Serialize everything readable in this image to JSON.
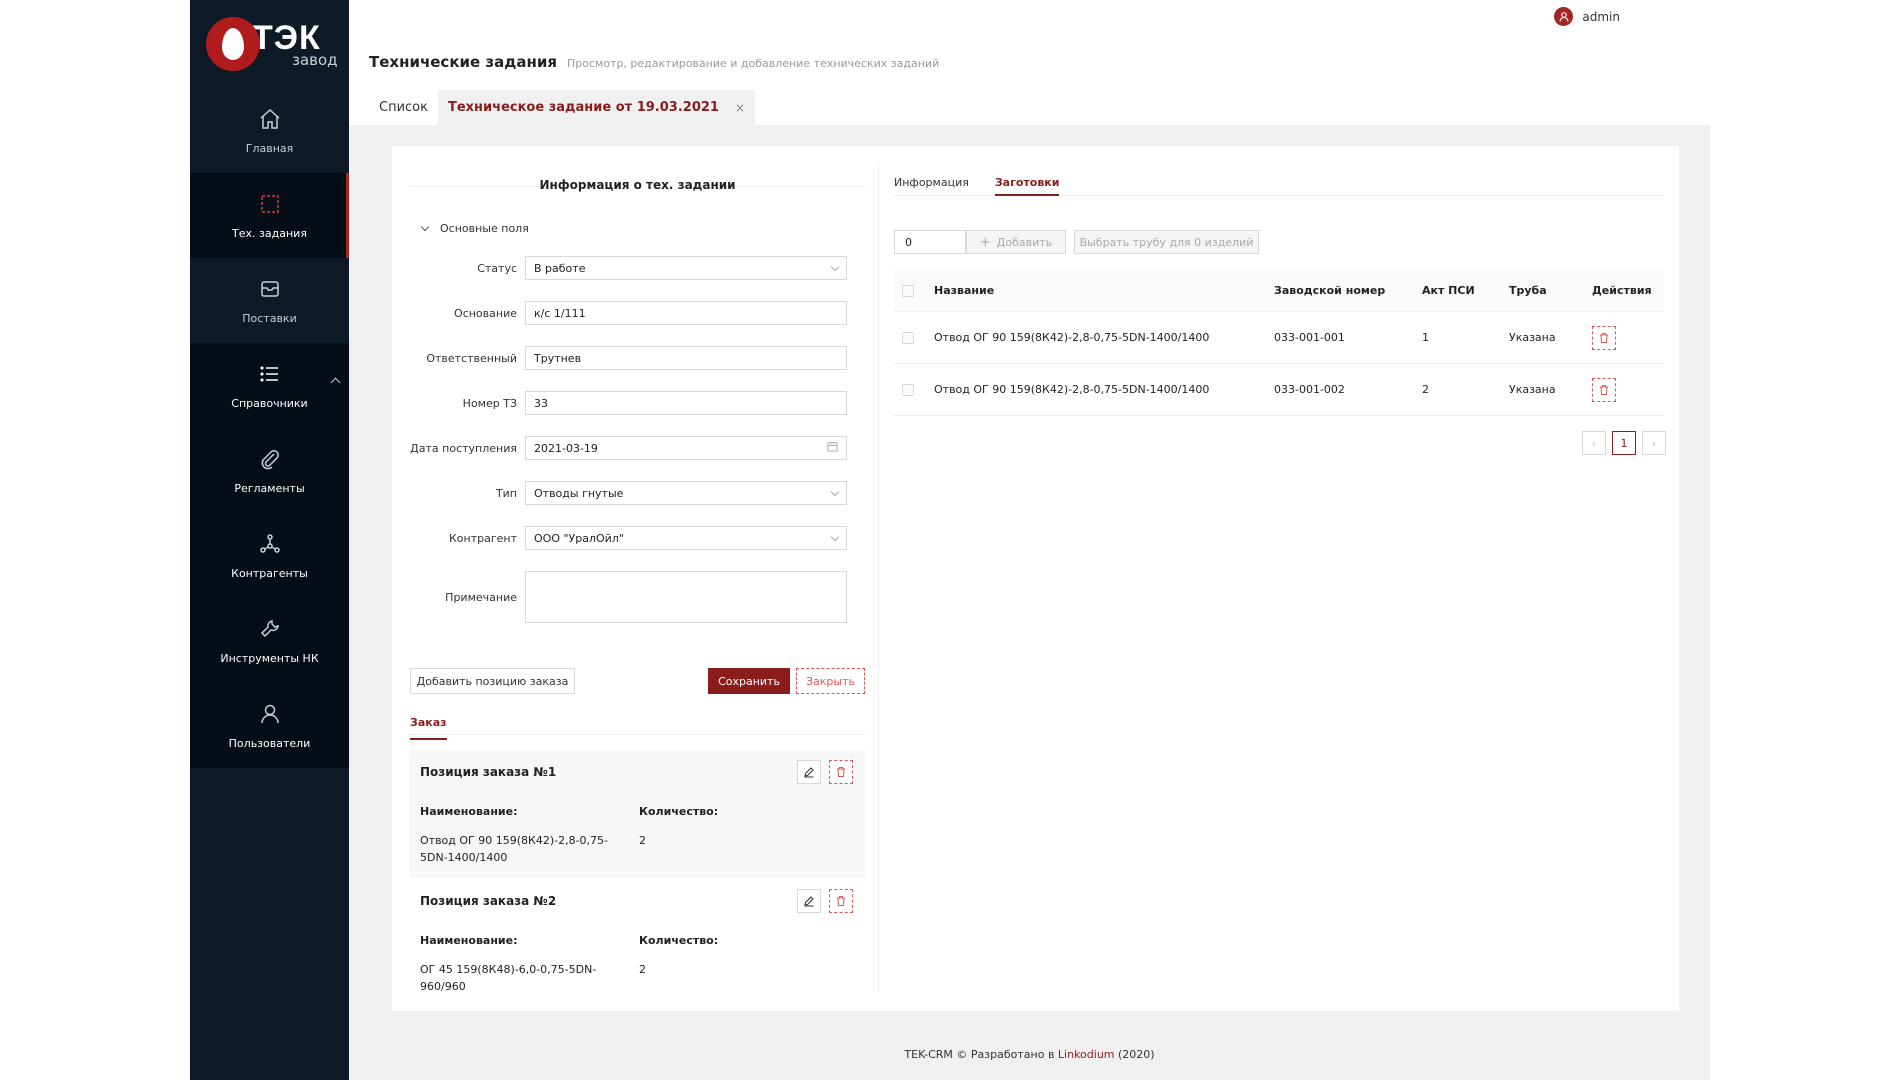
{
  "logo": {
    "big": "ТЭК",
    "small": "завод"
  },
  "sidebar": {
    "items": [
      {
        "label": "Главная",
        "icon": "home-icon"
      },
      {
        "label": "Тех. задания",
        "icon": "crop-frame-icon"
      },
      {
        "label": "Поставки",
        "icon": "inbox-icon"
      },
      {
        "label": "Справочники",
        "icon": "list-icon"
      },
      {
        "label": "Регламенты",
        "icon": "paperclip-icon"
      },
      {
        "label": "Контрагенты",
        "icon": "network-icon"
      },
      {
        "label": "Инструменты НК",
        "icon": "wrench-icon"
      },
      {
        "label": "Пользователи",
        "icon": "user-icon"
      }
    ]
  },
  "header": {
    "username": "admin"
  },
  "page": {
    "title": "Технические задания",
    "subtitle": "Просмотр, редактирование и добавление технических заданий",
    "tabs": [
      {
        "label": "Список"
      },
      {
        "label": "Техническое задание от 19.03.2021",
        "close": "×"
      }
    ]
  },
  "form": {
    "section_title": "Информация о тех. задании",
    "collapse_label": "Основные поля",
    "fields": [
      {
        "label": "Статус",
        "value": "В работе"
      },
      {
        "label": "Основание",
        "value": "к/с 1/111"
      },
      {
        "label": "Ответственный",
        "value": "Трутнев"
      },
      {
        "label": "Номер ТЗ",
        "value": "33"
      },
      {
        "label": "Дата поступления",
        "value": "2021-03-19"
      },
      {
        "label": "Тип",
        "value": "Отводы гнутые"
      },
      {
        "label": "Контрагент",
        "value": "ООО \"УралОйл\""
      },
      {
        "label": "Примечание",
        "value": ""
      }
    ],
    "add_position_label": "Добавить позицию заказа",
    "save_label": "Сохранить",
    "close_label": "Закрыть"
  },
  "order": {
    "tab_label": "Заказ",
    "name_label": "Наименование:",
    "qty_label": "Количество:",
    "positions": [
      {
        "title": "Позиция заказа №1",
        "name": "Отвод ОГ 90 159(8К42)-2,8-0,75-5DN-1400/1400",
        "qty": "2"
      },
      {
        "title": "Позиция заказа №2",
        "name": "ОГ 45 159(8К48)-6,0-0,75-5DN-960/960",
        "qty": "2"
      }
    ]
  },
  "right": {
    "tabs": [
      {
        "label": "Информация"
      },
      {
        "label": "Заготовки"
      }
    ],
    "qty_value": "0",
    "add_label": "Добавить",
    "pick_label": "Выбрать трубу для 0 изделий",
    "columns": {
      "name": "Название",
      "number": "Заводской номер",
      "act": "Акт ПСИ",
      "pipe": "Труба",
      "actions": "Действия"
    },
    "rows": [
      {
        "name": "Отвод ОГ 90 159(8К42)-2,8-0,75-5DN-1400/1400",
        "number": "033-001-001",
        "act": "1",
        "pipe": "Указана"
      },
      {
        "name": "Отвод ОГ 90 159(8К42)-2,8-0,75-5DN-1400/1400",
        "number": "033-001-002",
        "act": "2",
        "pipe": "Указана"
      }
    ],
    "pager": {
      "current": "1"
    }
  },
  "footer": {
    "prefix": "TEK-CRM © Разработано в",
    "link": "Linkodium",
    "suffix": "(2020)"
  },
  "colors": {
    "brand": "#8b1c1c",
    "sidebar": "#0e1a27",
    "danger": "#e05555"
  }
}
